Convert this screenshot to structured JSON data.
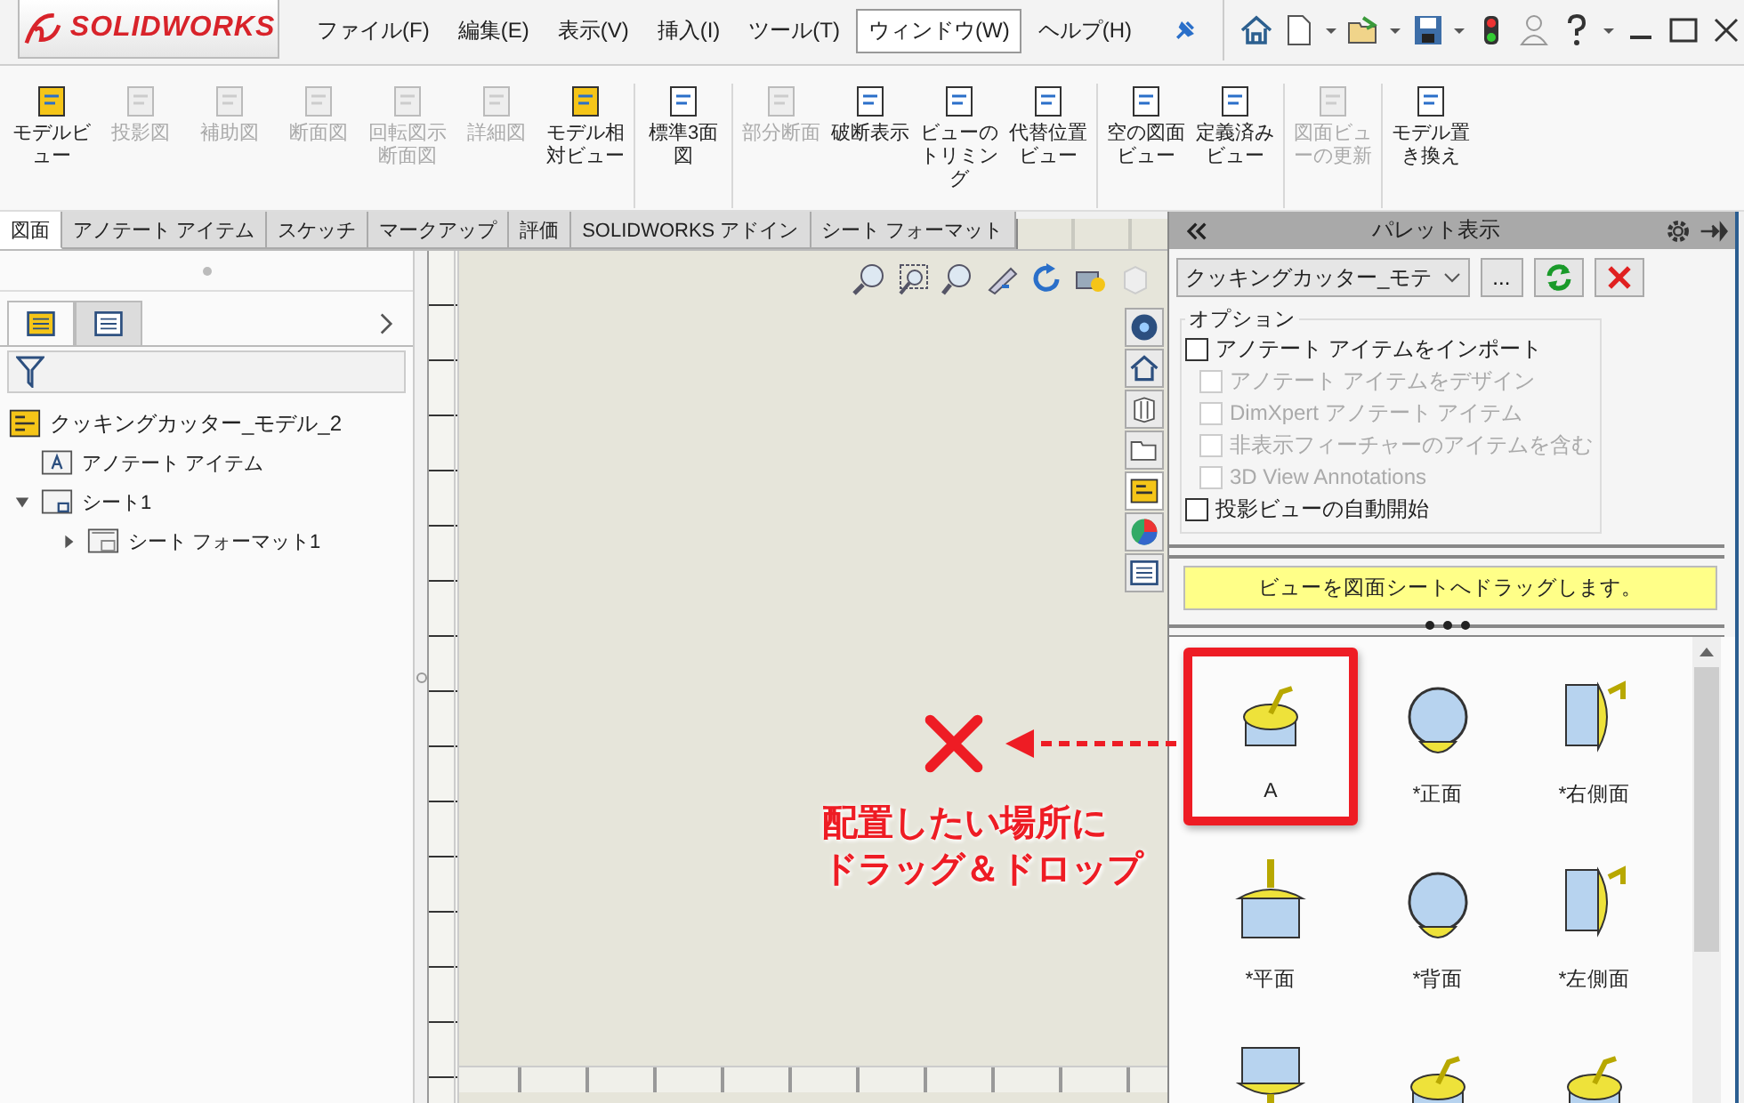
{
  "app": {
    "logo": "SOLIDWORKS"
  },
  "menu": [
    {
      "label": "ファイル(F)",
      "selected": false
    },
    {
      "label": "編集(E)",
      "selected": false
    },
    {
      "label": "表示(V)",
      "selected": false
    },
    {
      "label": "挿入(I)",
      "selected": false
    },
    {
      "label": "ツール(T)",
      "selected": false
    },
    {
      "label": "ウィンドウ(W)",
      "selected": true
    },
    {
      "label": "ヘルプ(H)",
      "selected": false
    }
  ],
  "ribbon_groups": [
    {
      "buttons": [
        {
          "label": "モデルビュー",
          "disabled": false
        },
        {
          "label": "投影図",
          "disabled": true
        },
        {
          "label": "補助図",
          "disabled": true
        },
        {
          "label": "断面図",
          "disabled": true
        },
        {
          "label": "回転図示断面図",
          "disabled": true
        },
        {
          "label": "詳細図",
          "disabled": true
        },
        {
          "label": "モデル相対ビュー",
          "disabled": false
        }
      ]
    },
    {
      "buttons": [
        {
          "label": "標準3面図",
          "disabled": false
        }
      ]
    },
    {
      "buttons": [
        {
          "label": "部分断面",
          "disabled": true
        },
        {
          "label": "破断表示",
          "disabled": false
        },
        {
          "label": "ビューのトリミング",
          "disabled": false
        },
        {
          "label": "代替位置ビュー",
          "disabled": false
        }
      ]
    },
    {
      "buttons": [
        {
          "label": "空の図面ビュー",
          "disabled": false
        },
        {
          "label": "定義済みビュー",
          "disabled": false
        }
      ]
    },
    {
      "buttons": [
        {
          "label": "図面ビューの更新",
          "disabled": true
        }
      ]
    },
    {
      "buttons": [
        {
          "label": "モデル置き換え",
          "disabled": false
        }
      ]
    }
  ],
  "command_tabs": [
    {
      "label": "図面",
      "selected": true
    },
    {
      "label": "アノテート アイテム",
      "selected": false
    },
    {
      "label": "スケッチ",
      "selected": false
    },
    {
      "label": "マークアップ",
      "selected": false
    },
    {
      "label": "評価",
      "selected": false
    },
    {
      "label": "SOLIDWORKS アドイン",
      "selected": false
    },
    {
      "label": "シート フォーマット",
      "selected": false
    }
  ],
  "left_panel": {
    "tabs": [
      {
        "selected": true
      },
      {
        "selected": false
      }
    ],
    "tree": [
      {
        "label": "クッキングカッター_モデル_2",
        "children": [
          {
            "label": "アノテート アイテム"
          },
          {
            "label": "シート1",
            "expanded": true,
            "children": [
              {
                "label": "シート フォーマット1",
                "expanded": false
              }
            ]
          }
        ]
      }
    ]
  },
  "annotation": {
    "lines": [
      "配置したい場所に",
      "ドラッグ＆ドロップ"
    ]
  },
  "palette": {
    "title": "パレット表示",
    "model": "クッキングカッター_モテ",
    "browse": "...",
    "options_title": "オプション",
    "options": [
      {
        "label": "アノテート アイテムをインポート",
        "checked": false,
        "disabled": false,
        "children": [
          {
            "label": "アノテート アイテムをデザイン",
            "checked": false,
            "disabled": true
          },
          {
            "label": "DimXpert アノテート アイテム",
            "checked": false,
            "disabled": true
          },
          {
            "label": "非表示フィーチャーのアイテムを含む",
            "checked": false,
            "disabled": true
          },
          {
            "label": "3D View Annotations",
            "checked": false,
            "disabled": true
          }
        ]
      },
      {
        "label": "投影ビューの自動開始",
        "checked": false,
        "disabled": false
      }
    ],
    "hint": "ビューを図面シートへドラッグします。",
    "views": [
      {
        "label": "A",
        "highlighted": true
      },
      {
        "label": "*正面",
        "highlighted": false
      },
      {
        "label": "*右側面",
        "highlighted": false
      },
      {
        "label": "*平面",
        "highlighted": false
      },
      {
        "label": "*背面",
        "highlighted": false
      },
      {
        "label": "*左側面",
        "highlighted": false
      },
      {
        "highlighted": false
      },
      {
        "highlighted": false
      },
      {
        "highlighted": false
      }
    ]
  }
}
